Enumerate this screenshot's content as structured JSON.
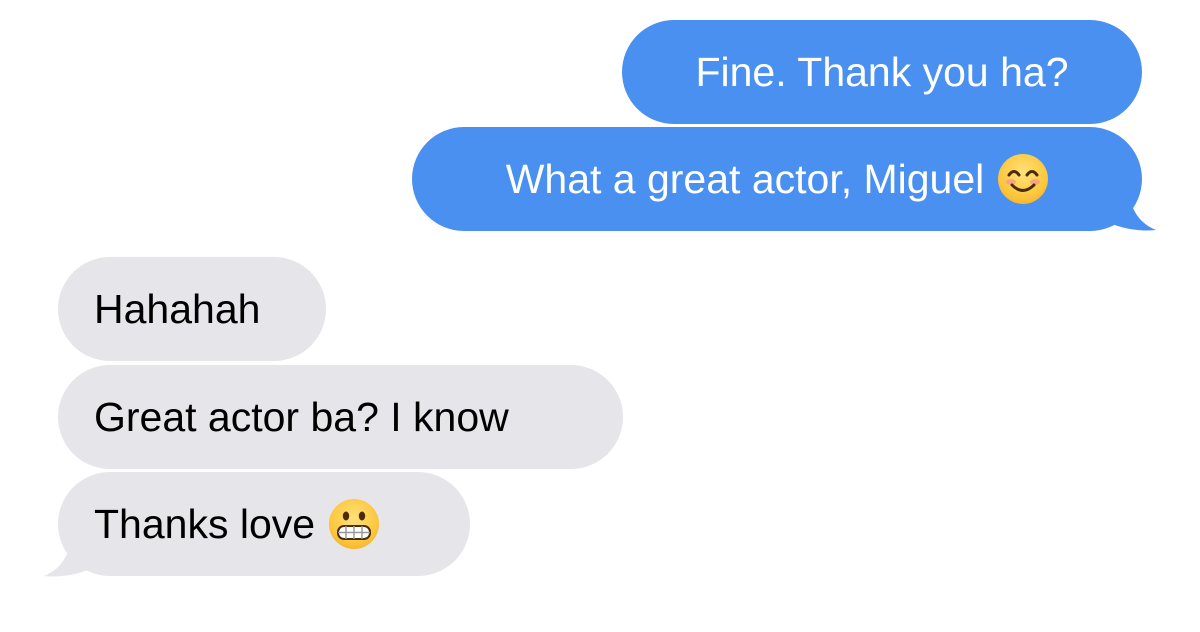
{
  "messages": [
    {
      "id": "m1",
      "direction": "sent",
      "text": "Fine. Thank you ha?",
      "emoji": ""
    },
    {
      "id": "m2",
      "direction": "sent",
      "text": "What a great actor, Miguel",
      "emoji": "smiling-face-with-smiling-eyes"
    },
    {
      "id": "m3",
      "direction": "received",
      "text": "Hahahah",
      "emoji": ""
    },
    {
      "id": "m4",
      "direction": "received",
      "text": "Great actor ba? I know",
      "emoji": ""
    },
    {
      "id": "m5",
      "direction": "received",
      "text": "Thanks love",
      "emoji": "grimacing-face"
    }
  ],
  "colors": {
    "sent_bubble": "#4a90f0",
    "sent_text": "#ffffff",
    "received_bubble": "#e5e5ea",
    "received_text": "#000000",
    "background": "#ffffff"
  }
}
